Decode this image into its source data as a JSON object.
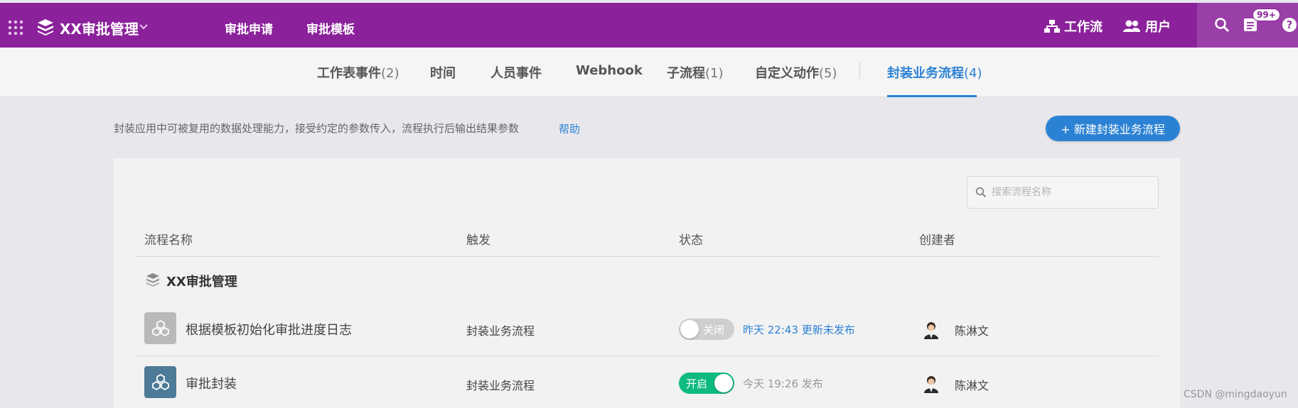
{
  "topbar": {
    "app_title": "XX审批管理",
    "nav": [
      "审批申请",
      "审批模板"
    ],
    "workflow_label": "工作流",
    "users_label": "用户",
    "badge": "99+",
    "bg_color": "#8b229b"
  },
  "tabs": [
    {
      "label": "工作表事件",
      "count": "(2)"
    },
    {
      "label": "时间",
      "count": ""
    },
    {
      "label": "人员事件",
      "count": ""
    },
    {
      "label": "Webhook",
      "count": ""
    },
    {
      "label": "子流程",
      "count": "(1)"
    },
    {
      "label": "自定义动作",
      "count": "(5)"
    },
    {
      "label": "封装业务流程",
      "count": "(4)"
    }
  ],
  "description": {
    "text": "封装应用中可被复用的数据处理能力，接受约定的参数传入，流程执行后输出结果参数",
    "help_link": "帮助"
  },
  "new_button": "+ 新建封装业务流程",
  "search": {
    "placeholder": "搜索流程名称",
    "value": ""
  },
  "table": {
    "headers": {
      "name": "流程名称",
      "trigger": "触发",
      "status": "状态",
      "creator": "创建者"
    },
    "group_title": "XX审批管理",
    "rows": [
      {
        "name": "根据模板初始化审批进度日志",
        "trigger": "封装业务流程",
        "toggle_label": "关闭",
        "enabled": false,
        "status_text": "昨天 22:43 更新未发布",
        "creator": "陈淋文"
      },
      {
        "name": "审批封装",
        "trigger": "封装业务流程",
        "toggle_label": "开启",
        "enabled": true,
        "status_text": "今天 19:26 发布",
        "creator": "陈淋文"
      }
    ]
  },
  "watermark": "CSDN @mingdaoyun",
  "colors": {
    "accent": "#2b82d4",
    "toggle_on": "#0fba7e",
    "toggle_off": "#cfcfcf"
  }
}
